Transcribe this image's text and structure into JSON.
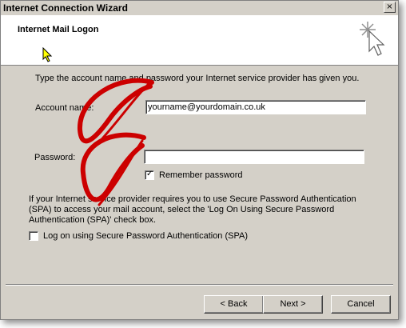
{
  "window": {
    "title": "Internet Connection Wizard",
    "close_glyph": "×"
  },
  "header": {
    "title": "Internet Mail Logon",
    "icon": "wizard-sparkle-icon"
  },
  "form": {
    "instructions": "Type the account name and password your Internet service provider has given you.",
    "account_label": "Account name:",
    "account_value": "yourname@yourdomain.co.uk",
    "password_label": "Password:",
    "password_value": "",
    "remember_label": "Remember password",
    "remember_checked": true,
    "spa_line1": "If your Internet service provider requires you to use Secure Password Authentication",
    "spa_line2": "(SPA) to access your mail account, select the 'Log On Using Secure Password",
    "spa_line3": "Authentication (SPA)' check box.",
    "spa_checkbox_label": "Log on using Secure Password Authentication (SPA)",
    "spa_checked": false
  },
  "buttons": {
    "back": "< Back",
    "next": "Next >",
    "cancel": "Cancel"
  },
  "colors": {
    "dialog_bg": "#d4d0c8",
    "annotation": "#cc0000"
  }
}
